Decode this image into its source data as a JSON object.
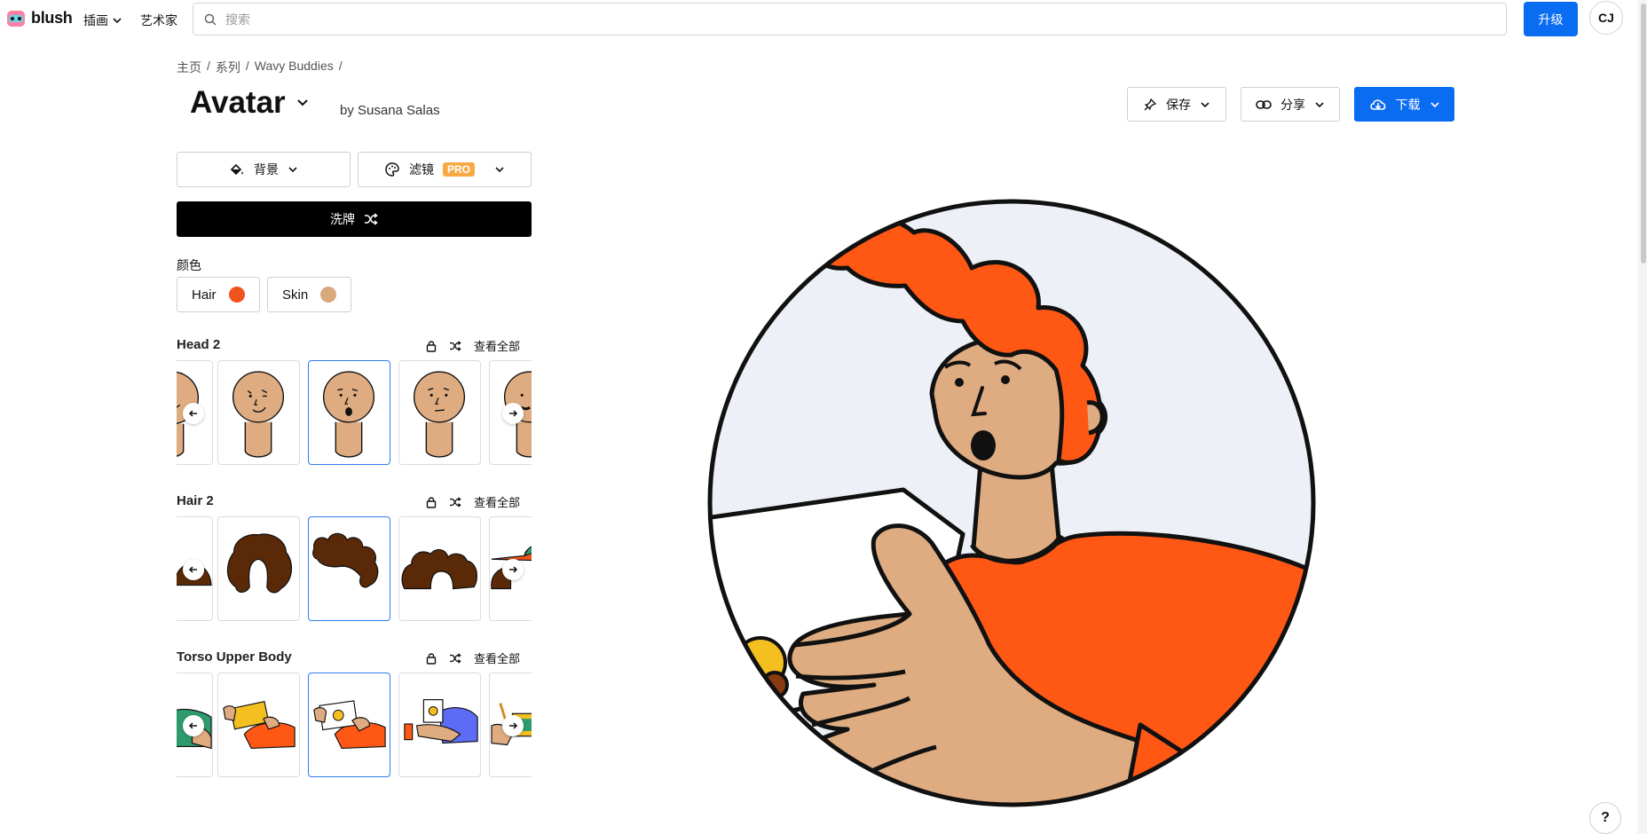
{
  "app": {
    "logo_text": "blush"
  },
  "nav": {
    "illustrations": "插画",
    "artists": "艺术家"
  },
  "search": {
    "placeholder": "搜索",
    "value": ""
  },
  "account": {
    "upgrade_label": "升级",
    "initials": "CJ"
  },
  "breadcrumb": [
    "主页",
    "系列",
    "Wavy Buddies"
  ],
  "page": {
    "title": "Avatar",
    "by_prefix": "by",
    "author": "Susana Salas"
  },
  "actions": {
    "save": "保存",
    "share": "分享",
    "download": "下载"
  },
  "controls": {
    "background": "背景",
    "filter": "滤镜",
    "pro_badge": "PRO",
    "shuffle": "洗牌",
    "colors_label": "颜色",
    "colors": [
      {
        "name": "Hair",
        "swatch": "#f0531b"
      },
      {
        "name": "Skin",
        "swatch": "#d8a97c"
      }
    ]
  },
  "sections": [
    {
      "title": "Head 2",
      "view_all": "查看全部",
      "selected_index": 2
    },
    {
      "title": "Hair 2",
      "view_all": "查看全部",
      "selected_index": 2
    },
    {
      "title": "Torso Upper Body",
      "view_all": "查看全部",
      "selected_index": 2
    }
  ],
  "colors": {
    "accent": "#0a6cf1",
    "hair": "#ff5714",
    "skin": "#deac80",
    "outline": "#111111",
    "background_panel": "#edf0f7",
    "pro": "#f7a944"
  },
  "help": {
    "label": "?"
  }
}
